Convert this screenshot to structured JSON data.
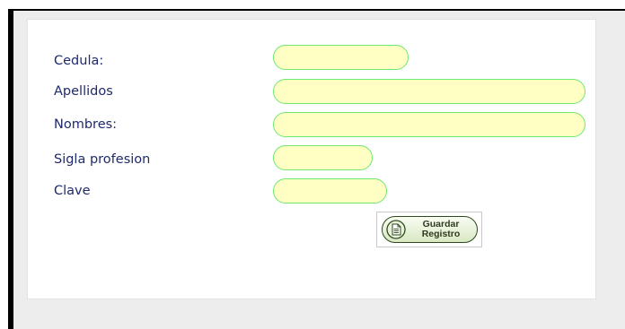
{
  "form": {
    "fields": [
      {
        "id": "cedula",
        "label": "Cedula:",
        "value": "",
        "placeholder": ""
      },
      {
        "id": "apellidos",
        "label": "Apellidos",
        "value": "",
        "placeholder": ""
      },
      {
        "id": "nombres",
        "label": "Nombres:",
        "value": "",
        "placeholder": ""
      },
      {
        "id": "sigla",
        "label": "Sigla profesion",
        "value": "",
        "placeholder": ""
      },
      {
        "id": "clave",
        "label": "Clave",
        "value": "",
        "placeholder": ""
      }
    ],
    "save_button": {
      "line1": "Guardar",
      "line2": "Registro",
      "icon": "document-icon"
    }
  },
  "colors": {
    "label": "#1f2a6b",
    "field_bg": "#ffffc4",
    "field_border": "#6ee86e",
    "frame_bg": "#ededed"
  }
}
